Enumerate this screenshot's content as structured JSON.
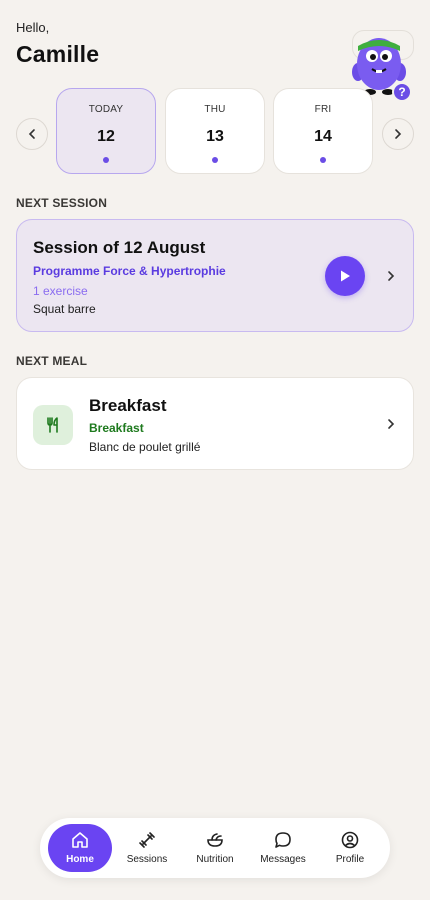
{
  "header": {
    "greeting": "Hello,",
    "user_name": "Camille",
    "help_badge": "?"
  },
  "days": [
    {
      "name": "TODAY",
      "number": "12",
      "active": true
    },
    {
      "name": "THU",
      "number": "13",
      "active": false
    },
    {
      "name": "FRI",
      "number": "14",
      "active": false
    }
  ],
  "next_session": {
    "section_label": "NEXT SESSION",
    "title": "Session of 12 August",
    "program": "Programme Force & Hypertrophie",
    "count": "1 exercise",
    "exercise": "Squat barre"
  },
  "next_meal": {
    "section_label": "NEXT MEAL",
    "title": "Breakfast",
    "type": "Breakfast",
    "description": "Blanc de poulet grillé"
  },
  "tabbar": {
    "tabs": [
      {
        "label": "Home",
        "icon": "home-icon",
        "active": true
      },
      {
        "label": "Sessions",
        "icon": "dumbbell-icon",
        "active": false
      },
      {
        "label": "Nutrition",
        "icon": "salad-bowl-icon",
        "active": false
      },
      {
        "label": "Messages",
        "icon": "chat-bubble-icon",
        "active": false
      },
      {
        "label": "Profile",
        "icon": "user-circle-icon",
        "active": false
      }
    ]
  },
  "colors": {
    "accent": "#6a44f2",
    "background": "#f5f2ee",
    "meal_green": "#1e7a1e"
  }
}
